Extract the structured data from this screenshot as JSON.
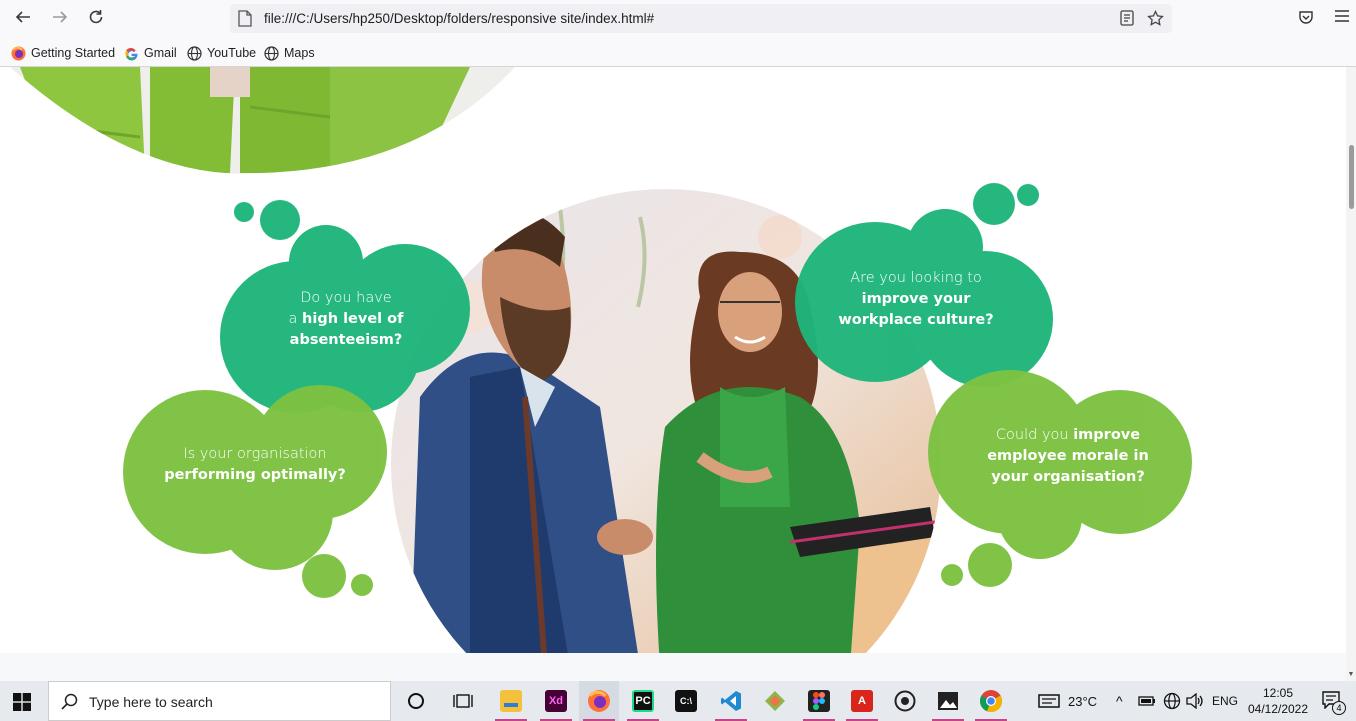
{
  "browser": {
    "url": "file:///C:/Users/hp250/Desktop/folders/responsive site/index.html#",
    "nav_icons": [
      "back-arrow-icon",
      "forward-arrow-icon",
      "reload-icon"
    ],
    "bookmarks": [
      {
        "label": "Getting Started",
        "icon": "firefox-icon"
      },
      {
        "label": "Gmail",
        "icon": "google-icon"
      },
      {
        "label": "YouTube",
        "icon": "globe-icon"
      },
      {
        "label": "Maps",
        "icon": "globe-icon"
      }
    ]
  },
  "page": {
    "bubbles": [
      {
        "light": "Do you have",
        "line2_prefix": "a ",
        "bold": "high level of",
        "bold2": "absenteeism?"
      },
      {
        "light": "Is your organisation",
        "bold": "performing optimally?"
      },
      {
        "light": "Are you looking to",
        "bold": "improve your",
        "bold2": "workplace culture?"
      },
      {
        "light_prefix": "Could you ",
        "bold_inline": "improve",
        "bold": "employee morale in",
        "bold2": "your organisation?"
      }
    ],
    "colors": {
      "teal": "#1fb57b",
      "lime": "#7dc242",
      "teal_bubble": "#1db37a",
      "lime_bubble": "#7cc143"
    }
  },
  "taskbar": {
    "search_placeholder": "Type here to search",
    "weather": "23°C",
    "language": "ENG",
    "time": "12:05",
    "date": "04/12/2022",
    "notification_count": "4"
  }
}
